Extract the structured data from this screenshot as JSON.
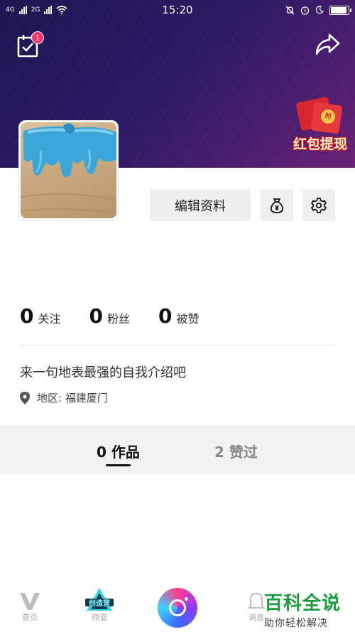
{
  "status_bar": {
    "time": "15:20",
    "signal_left": "4G",
    "signal_mid": "2G"
  },
  "header": {
    "task_badge_count": "1",
    "promo_text": "红包提现",
    "promo_seal": "開"
  },
  "profile": {
    "edit_button_label": "编辑资料"
  },
  "stats": [
    {
      "value": "0",
      "label": "关注"
    },
    {
      "value": "0",
      "label": "粉丝"
    },
    {
      "value": "0",
      "label": "被赞"
    }
  ],
  "bio": "来一句地表最强的自我介绍吧",
  "region": "地区: 福建厦门",
  "tabs": [
    {
      "count": "0",
      "label": "作品",
      "active": true
    },
    {
      "count": "2",
      "label": "赞过",
      "active": false
    }
  ],
  "bottom_nav": {
    "home_label": "首页",
    "channel_label": "频道",
    "channel_logo_text": "创造营",
    "messages_label": "消息"
  },
  "watermark": {
    "title": "百科全说",
    "subtitle": "助你轻松解决"
  },
  "colors": {
    "banner_dark": "#1d1551",
    "banner_purple": "#6a2274",
    "badge_pink": "#ff2d6f",
    "watermark_green": "#1a9e3d"
  }
}
